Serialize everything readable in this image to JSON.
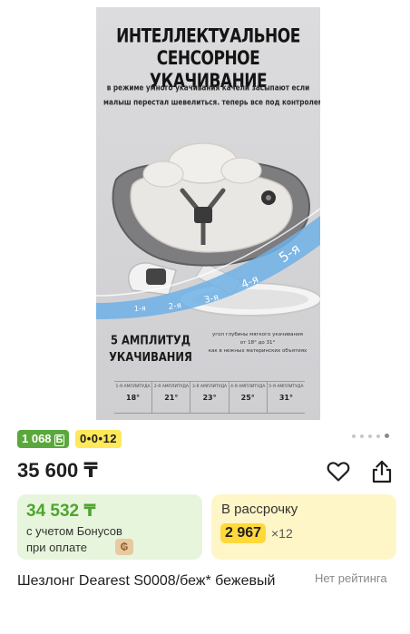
{
  "gallery": {
    "title_line1": "ИНТЕЛЛЕКТУАЛЬНОЕ",
    "title_line2": "СЕНСОРНОЕ УКАЧИВАНИЕ",
    "subtitle_line1": "в режиме умного укачивания качели засыпают если",
    "subtitle_line2": "малыш перестал шевелиться. теперь все под контролем",
    "level_labels": [
      "1-я",
      "2-я",
      "3-я",
      "4-я",
      "5-я"
    ],
    "amplitudes_title_line1": "5 АМПЛИТУД",
    "amplitudes_title_line2": "УКАЧИВАНИЯ",
    "angle_note_line1": "угол глубины мягкого укачивания",
    "angle_note_line2": "от 18° до 31°",
    "angle_note_line3": "как в нежных материнских объятиях",
    "amplitude_table": [
      {
        "label": "1-Я АМПЛИТУДА",
        "value": "18°"
      },
      {
        "label": "2-Я АМПЛИТУДА",
        "value": "21°"
      },
      {
        "label": "3-Я АМПЛИТУДА",
        "value": "23°"
      },
      {
        "label": "4-Я АМПЛИТУДА",
        "value": "25°"
      },
      {
        "label": "5-Я АМПЛИТУДА",
        "value": "31°"
      }
    ],
    "image_count": 5,
    "active_image_index": 4
  },
  "badges": {
    "bonus": "1 068",
    "bonus_currency": "Б",
    "installment": "0•0•12"
  },
  "price": {
    "current": "35 600 ₸"
  },
  "actions": {
    "favorite_icon": "heart-icon",
    "share_icon": "share-icon"
  },
  "bonus_card": {
    "price": "34 532 ₸",
    "line1": "с учетом Бонусов",
    "line2": "при оплате",
    "coin_symbol": "₲"
  },
  "installment_card": {
    "label": "В рассрочку",
    "amount": "2 967",
    "multiplier": "×12"
  },
  "product": {
    "title": "Шезлонг Dearest S0008/беж* бежевый",
    "rating": "Нет рейтинга"
  },
  "colors": {
    "green": "#5aa83c",
    "yellow": "#ffe85a",
    "bonus_card_bg": "#e7f5dc",
    "installment_card_bg": "#fff6c8"
  }
}
